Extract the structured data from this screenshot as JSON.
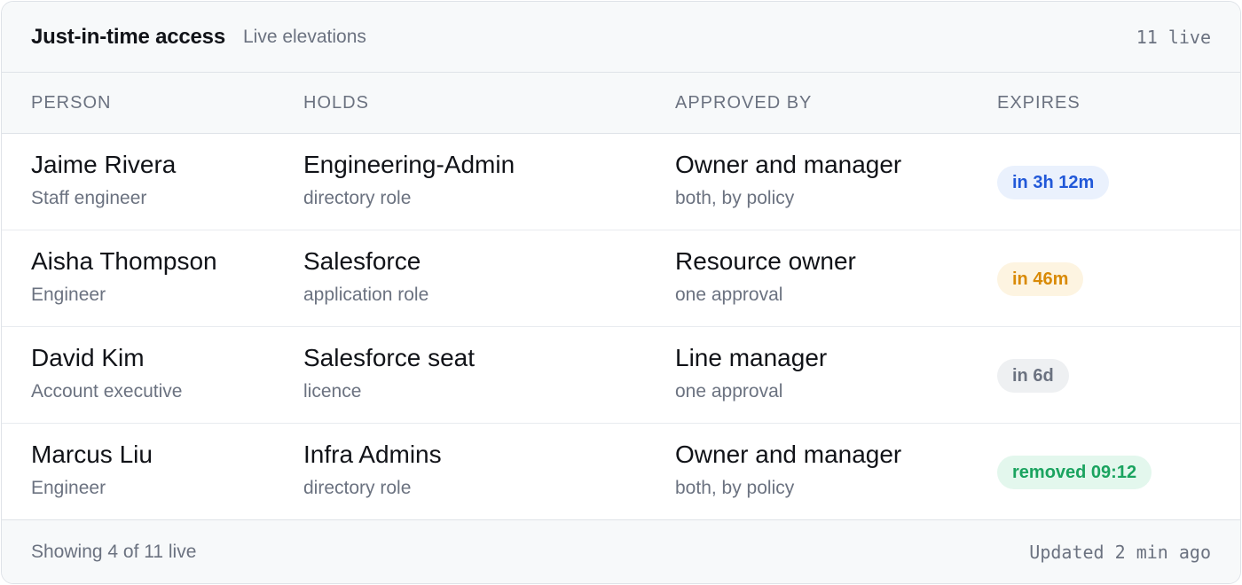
{
  "header": {
    "title": "Just-in-time access",
    "subtitle": "Live elevations",
    "live_count": "11 live"
  },
  "columns": [
    "PERSON",
    "HOLDS",
    "APPROVED BY",
    "EXPIRES"
  ],
  "rows": [
    {
      "person": "Jaime Rivera",
      "role": "Staff engineer",
      "holds": "Engineering-Admin",
      "holds_type": "directory role",
      "approved_by": "Owner and manager",
      "approval_detail": "both, by policy",
      "expires": "in 3h 12m",
      "expires_status": "blue"
    },
    {
      "person": "Aisha Thompson",
      "role": "Engineer",
      "holds": "Salesforce",
      "holds_type": "application role",
      "approved_by": "Resource owner",
      "approval_detail": "one approval",
      "expires": "in 46m",
      "expires_status": "amber"
    },
    {
      "person": "David Kim",
      "role": "Account executive",
      "holds": "Salesforce seat",
      "holds_type": "licence",
      "approved_by": "Line manager",
      "approval_detail": "one approval",
      "expires": "in 6d",
      "expires_status": "gray"
    },
    {
      "person": "Marcus Liu",
      "role": "Engineer",
      "holds": "Infra Admins",
      "holds_type": "directory role",
      "approved_by": "Owner and manager",
      "approval_detail": "both, by policy",
      "expires": "removed 09:12",
      "expires_status": "green"
    }
  ],
  "footer": {
    "showing": "Showing 4 of 11 live",
    "updated": "Updated 2 min ago"
  },
  "colors": {
    "blue": "#2158d8",
    "amber": "#d98a06",
    "gray": "#6b7280",
    "green": "#1aa35f"
  }
}
